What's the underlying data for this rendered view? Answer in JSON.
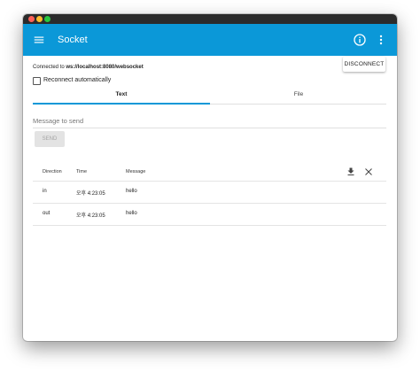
{
  "app": {
    "title": "Socket"
  },
  "icons": {
    "menu": "menu-icon",
    "info": "info-icon",
    "more": "more-vert-icon",
    "download": "download-icon",
    "clear": "close-icon"
  },
  "connection": {
    "prefix": "Connected to ",
    "url": "ws://localhost:8080/websocket",
    "disconnect_label": "DISCONNECT"
  },
  "options": {
    "reconnect_label": "Reconnect automatically",
    "reconnect_checked": false
  },
  "tabs": [
    {
      "label": "Text",
      "active": true
    },
    {
      "label": "File",
      "active": false
    }
  ],
  "composer": {
    "placeholder": "Message to send",
    "value": "",
    "send_label": "SEND"
  },
  "log": {
    "columns": [
      "Direction",
      "Time",
      "Message"
    ],
    "rows": [
      {
        "direction": "in",
        "time": "오후 4:23:05",
        "message": "hello"
      },
      {
        "direction": "out",
        "time": "오후 4:23:05",
        "message": "hello"
      }
    ]
  },
  "colors": {
    "primary": "#0b98d8",
    "titlebar": "#2b2b2b",
    "send_disabled_bg": "#e3e3e3",
    "send_disabled_text": "#a5a5a5"
  }
}
